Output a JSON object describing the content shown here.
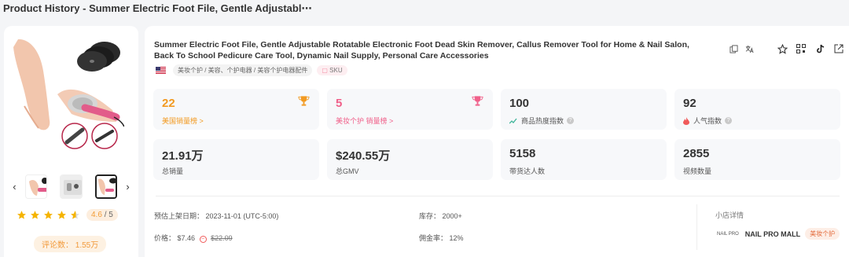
{
  "header": {
    "title": "Product History - Summer Electric Foot File, Gentle Adjustabl⋯"
  },
  "gallery": {
    "prev_arrow": "‹",
    "next_arrow": "›"
  },
  "rating": {
    "score": "4.6",
    "max": "/ 5",
    "stars": 4.6
  },
  "reviews": {
    "label": "评论数：",
    "value": "1.55万"
  },
  "product": {
    "title": "Summer Electric Foot File, Gentle Adjustable Rotatable Electronic Foot Dead Skin Remover, Callus Remover Tool for Home & Nail Salon, Back To School Pedicure Care Tool, Dynamic Nail Supply, Personal Care Accessories",
    "category": "美妆个护 / 美容、个护电器 / 美容个护电器配件",
    "sku_label": "SKU"
  },
  "stats": [
    {
      "value": "22",
      "label": "美国销量榜 >"
    },
    {
      "value": "5",
      "label": "美妆个护 销量榜 >"
    },
    {
      "value": "100",
      "label": "商品热度指数"
    },
    {
      "value": "92",
      "label": "人气指数"
    },
    {
      "value": "21.91万",
      "label": "总销量"
    },
    {
      "value": "$240.55万",
      "label": "总GMV"
    },
    {
      "value": "5158",
      "label": "带货达人数"
    },
    {
      "value": "2855",
      "label": "视频数量"
    }
  ],
  "info": {
    "listed_label": "预估上架日期：",
    "listed_value": "2023-11-01 (UTC-5:00)",
    "stock_label": "库存：",
    "stock_value": "2000+",
    "price_label": "价格：",
    "price_value": "$7.46",
    "price_original": "$22.09",
    "commission_label": "佣金率：",
    "commission_value": "12%"
  },
  "shop": {
    "title": "小店详情",
    "logo_text": "NAIL PRO",
    "name": "NAIL PRO MALL",
    "tag": "美妆个护"
  },
  "colors": {
    "orange": "#f29a22",
    "pink": "#f0608a",
    "green": "#3fb59a",
    "red": "#f05a5a"
  }
}
